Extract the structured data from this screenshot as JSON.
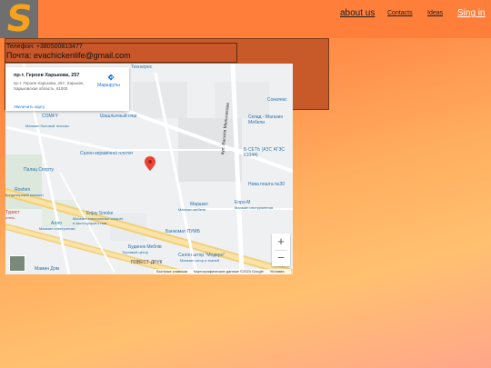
{
  "header": {
    "logo_letter": "S",
    "nav": {
      "about": "about us",
      "contacts": "Contacts",
      "ideas": "Ideas",
      "signin": "Sing in"
    }
  },
  "contact": {
    "phone": "Телефон: +380500813477",
    "email": "Почта: evachickenlife@gmail.com"
  },
  "map": {
    "place_title": "пр-т. Героев Харькова, 257",
    "place_address": "пр-т. Героев Харькова, 257, Харьков, Харьковская область, 61000",
    "route_label": "Маршруты",
    "enlarge_link": "Увеличить карту",
    "zoom_in": "+",
    "zoom_out": "−",
    "attribution": [
      "Быстрые клавиши",
      "Картографические данные ©2023 Google",
      "Условия"
    ],
    "pois": {
      "tehnogres": "Техногрес",
      "sonatex": "Сонатекс",
      "sklad": "Склад - Магазин Мебели",
      "comfy": "COMFY",
      "comfy_sub": "Магазин бытовой техники",
      "shashlik": "Шашлычный очаг",
      "salon_ceramic": "Салон керамічної плитки",
      "b_set": "Б-СЕТЬ (АЗС АГЗС 61044)",
      "palace_sport": "Палац Спорту",
      "nova_poshta": "Нова пошта №30",
      "roshen": "Roshen",
      "roshen_sub": "Кондитерский магазин",
      "marshal": "Маршал",
      "marshal_sub": "Магазин мебели",
      "epro": "Епро-М",
      "epro_sub": "Магазин инструментов",
      "tourist": "Турист",
      "tourist_sub": "отель",
      "enjoy": "Enjoy Smoke",
      "enjoy_sub": "Магазин электронных сигарет и аксессуаров к ним",
      "allo": "Алло",
      "allo_sub": "Магазин электроники",
      "bankomat": "Банкомат ПУМБ",
      "budinok": "Будинок Меблів",
      "budinok_sub": "Торговый центр",
      "salon_shtor": "Салон штор \"Модерн\"",
      "salon_shtor_sub": "Магазин штор и тканей",
      "mami_dom": "Мамин Дом",
      "mami_dom_sub": "Ресторан",
      "plvest": "ПЛВЕСТ-ДРУК",
      "street": "вул. Василя Мельникова"
    }
  }
}
